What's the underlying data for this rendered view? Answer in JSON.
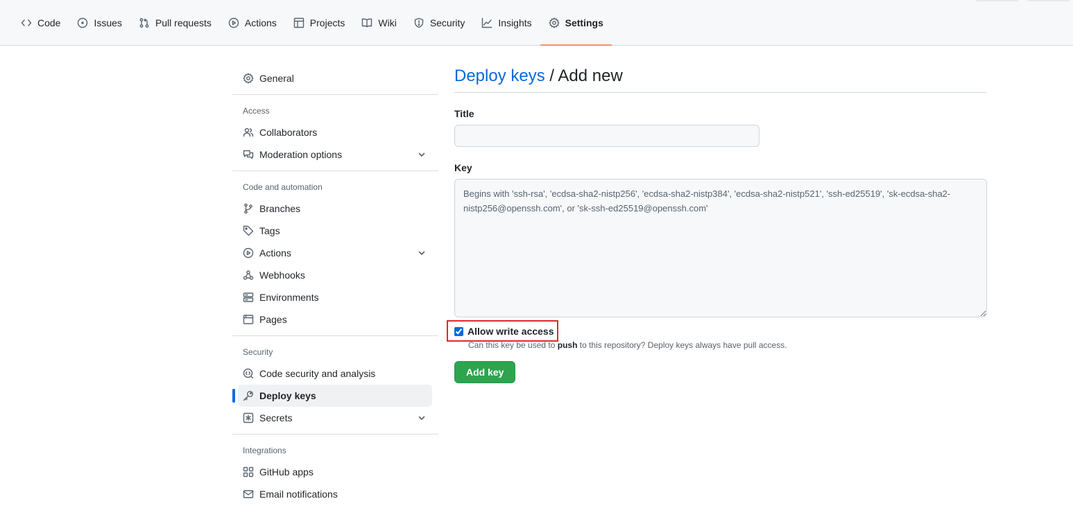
{
  "repo_nav": {
    "tabs": [
      {
        "label": "Code",
        "icon": "code-icon"
      },
      {
        "label": "Issues",
        "icon": "issue-icon"
      },
      {
        "label": "Pull requests",
        "icon": "pull-request-icon"
      },
      {
        "label": "Actions",
        "icon": "play-icon"
      },
      {
        "label": "Projects",
        "icon": "table-icon"
      },
      {
        "label": "Wiki",
        "icon": "book-icon"
      },
      {
        "label": "Security",
        "icon": "shield-icon"
      },
      {
        "label": "Insights",
        "icon": "graph-icon"
      },
      {
        "label": "Settings",
        "icon": "gear-icon",
        "active": true
      }
    ]
  },
  "sidebar": {
    "general": "General",
    "access_heading": "Access",
    "collaborators": "Collaborators",
    "moderation": "Moderation options",
    "code_heading": "Code and automation",
    "branches": "Branches",
    "tags": "Tags",
    "actions": "Actions",
    "webhooks": "Webhooks",
    "environments": "Environments",
    "pages": "Pages",
    "security_heading": "Security",
    "code_security": "Code security and analysis",
    "deploy_keys": "Deploy keys",
    "secrets": "Secrets",
    "integrations_heading": "Integrations",
    "github_apps": "GitHub apps",
    "email_notifications": "Email notifications"
  },
  "main": {
    "title_link": "Deploy keys",
    "title_rest": " / Add new",
    "title_label": "Title",
    "title_value": "",
    "key_label": "Key",
    "key_placeholder": "Begins with 'ssh-rsa', 'ecdsa-sha2-nistp256', 'ecdsa-sha2-nistp384', 'ecdsa-sha2-nistp521', 'ssh-ed25519', 'sk-ecdsa-sha2-nistp256@openssh.com', or 'sk-ssh-ed25519@openssh.com'",
    "allow_write_label": "Allow write access",
    "allow_write_checked": true,
    "hint_pre": "Can this key be used to ",
    "hint_bold": "push",
    "hint_post": " to this repository? Deploy keys always have pull access.",
    "submit_label": "Add key"
  },
  "colors": {
    "link": "#0969da",
    "active_underline": "#fd8c73",
    "primary_button": "#2da44e",
    "highlight_box": "#e0282e"
  }
}
